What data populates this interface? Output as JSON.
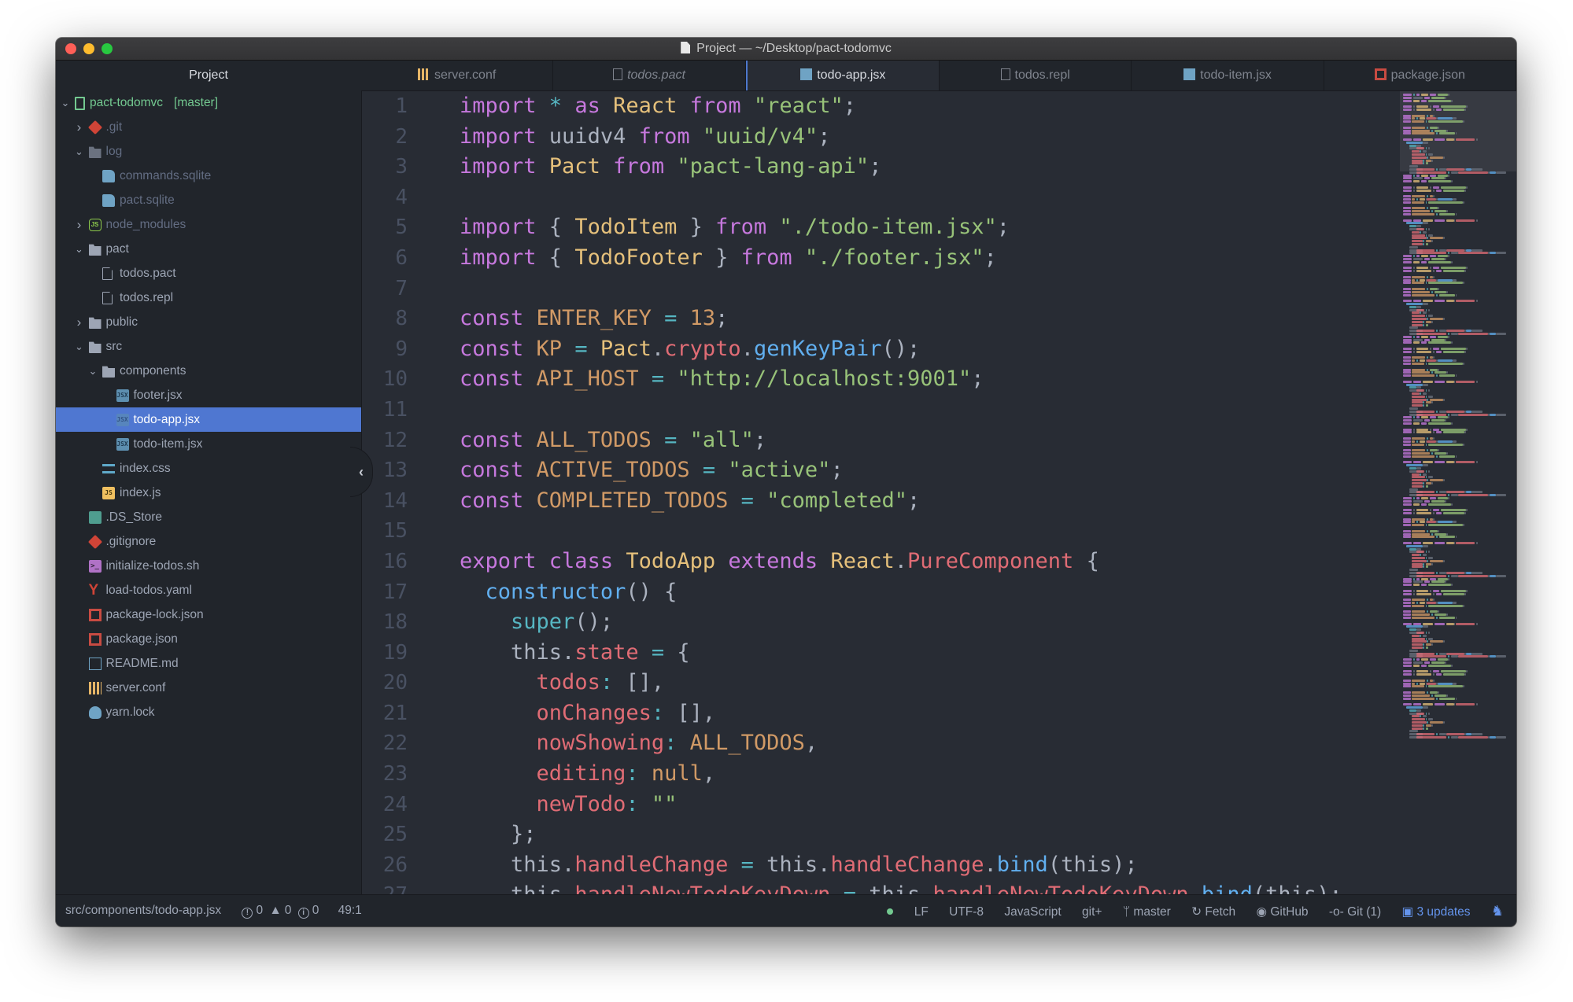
{
  "window": {
    "title": "Project — ~/Desktop/pact-todomvc"
  },
  "sidebar": {
    "header": "Project",
    "root": {
      "name": "pact-todomvc",
      "branch": "[master]"
    },
    "items": [
      {
        "label": ".git",
        "depth": 1,
        "kind": "git",
        "expanded": false,
        "dim": true
      },
      {
        "label": "log",
        "depth": 1,
        "kind": "folder",
        "expanded": true,
        "dim": true
      },
      {
        "label": "commands.sqlite",
        "depth": 2,
        "kind": "sqlite",
        "dim": true
      },
      {
        "label": "pact.sqlite",
        "depth": 2,
        "kind": "sqlite",
        "dim": true
      },
      {
        "label": "node_modules",
        "depth": 1,
        "kind": "node",
        "expanded": false,
        "dim": true
      },
      {
        "label": "pact",
        "depth": 1,
        "kind": "folder",
        "expanded": true
      },
      {
        "label": "todos.pact",
        "depth": 2,
        "kind": "file"
      },
      {
        "label": "todos.repl",
        "depth": 2,
        "kind": "file"
      },
      {
        "label": "public",
        "depth": 1,
        "kind": "folder",
        "expanded": false
      },
      {
        "label": "src",
        "depth": 1,
        "kind": "folder",
        "expanded": true
      },
      {
        "label": "components",
        "depth": 2,
        "kind": "folder",
        "expanded": true
      },
      {
        "label": "footer.jsx",
        "depth": 3,
        "kind": "jsx"
      },
      {
        "label": "todo-app.jsx",
        "depth": 3,
        "kind": "jsx",
        "selected": true
      },
      {
        "label": "todo-item.jsx",
        "depth": 3,
        "kind": "jsx"
      },
      {
        "label": "index.css",
        "depth": 2,
        "kind": "css"
      },
      {
        "label": "index.js",
        "depth": 2,
        "kind": "js"
      },
      {
        "label": ".DS_Store",
        "depth": 1,
        "kind": "finder"
      },
      {
        "label": ".gitignore",
        "depth": 1,
        "kind": "git"
      },
      {
        "label": "initialize-todos.sh",
        "depth": 1,
        "kind": "shell"
      },
      {
        "label": "load-todos.yaml",
        "depth": 1,
        "kind": "yaml"
      },
      {
        "label": "package-lock.json",
        "depth": 1,
        "kind": "npm"
      },
      {
        "label": "package.json",
        "depth": 1,
        "kind": "npm"
      },
      {
        "label": "README.md",
        "depth": 1,
        "kind": "readme"
      },
      {
        "label": "server.conf",
        "depth": 1,
        "kind": "config"
      },
      {
        "label": "yarn.lock",
        "depth": 1,
        "kind": "yarn"
      }
    ]
  },
  "tabs": [
    {
      "label": "server.conf",
      "icon": "config",
      "active": false,
      "italic": false
    },
    {
      "label": "todos.pact",
      "icon": "file",
      "active": false,
      "italic": true
    },
    {
      "label": "todo-app.jsx",
      "icon": "jsx",
      "active": true,
      "italic": false
    },
    {
      "label": "todos.repl",
      "icon": "file",
      "active": false,
      "italic": false
    },
    {
      "label": "todo-item.jsx",
      "icon": "jsx",
      "active": false,
      "italic": false
    },
    {
      "label": "package.json",
      "icon": "npm",
      "active": false,
      "italic": false
    }
  ],
  "editor": {
    "lines": [
      [
        [
          "k",
          "import "
        ],
        [
          "o",
          "* "
        ],
        [
          "k",
          "as "
        ],
        [
          "t",
          "React "
        ],
        [
          "k",
          "from "
        ],
        [
          "s",
          "\"react\""
        ],
        [
          "x",
          ";"
        ]
      ],
      [
        [
          "k",
          "import "
        ],
        [
          "x",
          "uuidv4 "
        ],
        [
          "k",
          "from "
        ],
        [
          "s",
          "\"uuid/v4\""
        ],
        [
          "x",
          ";"
        ]
      ],
      [
        [
          "k",
          "import "
        ],
        [
          "t",
          "Pact "
        ],
        [
          "k",
          "from "
        ],
        [
          "s",
          "\"pact-lang-api\""
        ],
        [
          "x",
          ";"
        ]
      ],
      [],
      [
        [
          "k",
          "import "
        ],
        [
          "x",
          "{ "
        ],
        [
          "t",
          "TodoItem "
        ],
        [
          "x",
          "} "
        ],
        [
          "k",
          "from "
        ],
        [
          "s",
          "\"./todo-item.jsx\""
        ],
        [
          "x",
          ";"
        ]
      ],
      [
        [
          "k",
          "import "
        ],
        [
          "x",
          "{ "
        ],
        [
          "t",
          "TodoFooter "
        ],
        [
          "x",
          "} "
        ],
        [
          "k",
          "from "
        ],
        [
          "s",
          "\"./footer.jsx\""
        ],
        [
          "x",
          ";"
        ]
      ],
      [],
      [
        [
          "k",
          "const "
        ],
        [
          "c",
          "ENTER_KEY "
        ],
        [
          "o",
          "= "
        ],
        [
          "c",
          "13"
        ],
        [
          "x",
          ";"
        ]
      ],
      [
        [
          "k",
          "const "
        ],
        [
          "c",
          "KP "
        ],
        [
          "o",
          "= "
        ],
        [
          "t",
          "Pact"
        ],
        [
          "x",
          "."
        ],
        [
          "p",
          "crypto"
        ],
        [
          "x",
          "."
        ],
        [
          "f",
          "genKeyPair"
        ],
        [
          "x",
          "();"
        ]
      ],
      [
        [
          "k",
          "const "
        ],
        [
          "c",
          "API_HOST "
        ],
        [
          "o",
          "= "
        ],
        [
          "s",
          "\"http://localhost:9001\""
        ],
        [
          "x",
          ";"
        ]
      ],
      [],
      [
        [
          "k",
          "const "
        ],
        [
          "c",
          "ALL_TODOS "
        ],
        [
          "o",
          "= "
        ],
        [
          "s",
          "\"all\""
        ],
        [
          "x",
          ";"
        ]
      ],
      [
        [
          "k",
          "const "
        ],
        [
          "c",
          "ACTIVE_TODOS "
        ],
        [
          "o",
          "= "
        ],
        [
          "s",
          "\"active\""
        ],
        [
          "x",
          ";"
        ]
      ],
      [
        [
          "k",
          "const "
        ],
        [
          "c",
          "COMPLETED_TODOS "
        ],
        [
          "o",
          "= "
        ],
        [
          "s",
          "\"completed\""
        ],
        [
          "x",
          ";"
        ]
      ],
      [],
      [
        [
          "k",
          "export "
        ],
        [
          "k",
          "class "
        ],
        [
          "t",
          "TodoApp "
        ],
        [
          "k",
          "extends "
        ],
        [
          "t",
          "React"
        ],
        [
          "x",
          "."
        ],
        [
          "p",
          "PureComponent "
        ],
        [
          "x",
          "{"
        ]
      ],
      [
        [
          "x",
          "  "
        ],
        [
          "f",
          "constructor"
        ],
        [
          "x",
          "() {"
        ]
      ],
      [
        [
          "x",
          "    "
        ],
        [
          "o",
          "super"
        ],
        [
          "x",
          "();"
        ]
      ],
      [
        [
          "x",
          "    this."
        ],
        [
          "p",
          "state "
        ],
        [
          "o",
          "= "
        ],
        [
          "x",
          "{"
        ]
      ],
      [
        [
          "x",
          "      "
        ],
        [
          "p",
          "todos"
        ],
        [
          "o",
          ": "
        ],
        [
          "x",
          "[],"
        ]
      ],
      [
        [
          "x",
          "      "
        ],
        [
          "p",
          "onChanges"
        ],
        [
          "o",
          ": "
        ],
        [
          "x",
          "[],"
        ]
      ],
      [
        [
          "x",
          "      "
        ],
        [
          "p",
          "nowShowing"
        ],
        [
          "o",
          ": "
        ],
        [
          "c",
          "ALL_TODOS"
        ],
        [
          "x",
          ","
        ]
      ],
      [
        [
          "x",
          "      "
        ],
        [
          "p",
          "editing"
        ],
        [
          "o",
          ": "
        ],
        [
          "c",
          "null"
        ],
        [
          "x",
          ","
        ]
      ],
      [
        [
          "x",
          "      "
        ],
        [
          "p",
          "newTodo"
        ],
        [
          "o",
          ": "
        ],
        [
          "s",
          "\"\""
        ]
      ],
      [
        [
          "x",
          "    };"
        ]
      ],
      [
        [
          "x",
          "    this."
        ],
        [
          "p",
          "handleChange "
        ],
        [
          "o",
          "= "
        ],
        [
          "x",
          "this."
        ],
        [
          "p",
          "handleChange"
        ],
        [
          "x",
          "."
        ],
        [
          "f",
          "bind"
        ],
        [
          "x",
          "(this);"
        ]
      ],
      [
        [
          "x",
          "    this."
        ],
        [
          "p",
          "handleNewTodoKeyDown "
        ],
        [
          "o",
          "= "
        ],
        [
          "x",
          "this."
        ],
        [
          "p",
          "handleNewTodoKeyDown"
        ],
        [
          "x",
          "."
        ],
        [
          "f",
          "bind"
        ],
        [
          "x",
          "(this);"
        ]
      ]
    ]
  },
  "statusbar": {
    "path": "src/components/todo-app.jsx",
    "errors": "0",
    "warnings": "0",
    "infos": "0",
    "cursor": "49:1",
    "line_ending": "LF",
    "encoding": "UTF-8",
    "grammar": "JavaScript",
    "git_plus": "git+",
    "branch": "master",
    "fetch": "Fetch",
    "github": "GitHub",
    "git": "Git (1)",
    "updates": "3 updates"
  },
  "colors": {
    "accent": "#4f77d1",
    "keyword": "#c678dd",
    "string": "#98c379",
    "type": "#e5c07b",
    "property": "#e06c75",
    "function": "#61afef",
    "constant": "#d19a66",
    "operator": "#56b6c2",
    "git_ok": "#73c990",
    "updates": "#6494ed"
  }
}
